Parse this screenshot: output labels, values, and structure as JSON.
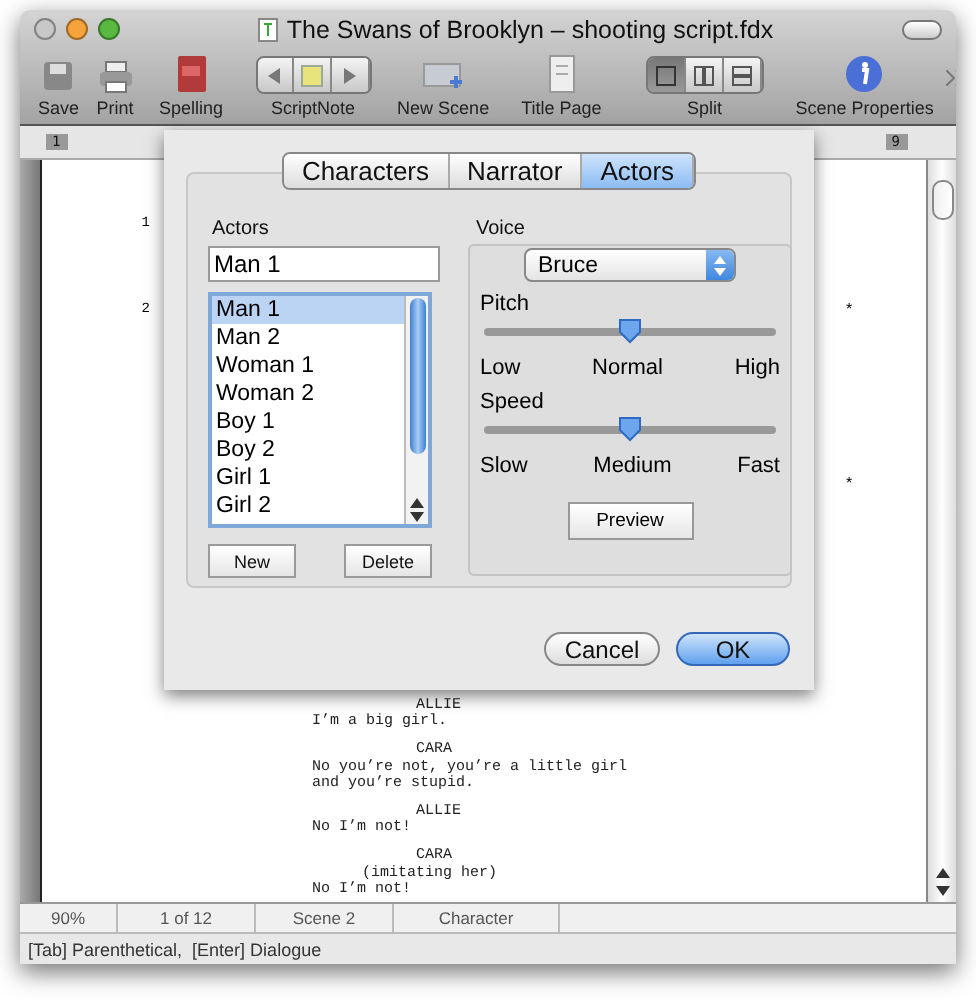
{
  "window": {
    "title": "The Swans of Brooklyn – shooting script.fdx"
  },
  "toolbar": {
    "items": [
      {
        "kind": "save",
        "label": "Save"
      },
      {
        "kind": "print",
        "label": "Print"
      },
      {
        "kind": "spelling",
        "label": "Spelling"
      },
      {
        "kind": "scriptnote",
        "label": "ScriptNote"
      },
      {
        "kind": "newscene",
        "label": "New Scene"
      },
      {
        "kind": "titlepage",
        "label": "Title Page"
      },
      {
        "kind": "split",
        "label": "Split",
        "segments": [
          {
            "kind": "single",
            "selected": true
          },
          {
            "kind": "columns",
            "selected": false
          },
          {
            "kind": "rows",
            "selected": false
          }
        ]
      },
      {
        "kind": "info",
        "label": "Scene Properties"
      }
    ]
  },
  "ruler": {
    "left_label": "1",
    "right_label": "9"
  },
  "page": {
    "scene_numbers": [
      "1",
      "2"
    ],
    "marks": [
      "*",
      "*"
    ],
    "script": [
      {
        "kind": "character",
        "text": "ALLIE"
      },
      {
        "kind": "dialogue",
        "text": "I’m a big girl."
      },
      {
        "kind": "character",
        "text": "CARA"
      },
      {
        "kind": "dialogue",
        "text": "No you’re not, you’re a little girl"
      },
      {
        "kind": "dialogue",
        "text": "and you’re stupid."
      },
      {
        "kind": "character",
        "text": "ALLIE"
      },
      {
        "kind": "dialogue",
        "text": "No I’m not!"
      },
      {
        "kind": "character",
        "text": "CARA"
      },
      {
        "kind": "parenthetical",
        "text": "(imitating her)"
      },
      {
        "kind": "dialogue",
        "text": "No I’m not!"
      }
    ]
  },
  "dialog": {
    "tabs": [
      {
        "label": "Characters",
        "selected": false
      },
      {
        "label": "Narrator",
        "selected": false
      },
      {
        "label": "Actors",
        "selected": true
      }
    ],
    "actors": {
      "label": "Actors",
      "name_value": "Man 1",
      "list": [
        {
          "label": "Man 1",
          "selected": true
        },
        {
          "label": "Man 2",
          "selected": false
        },
        {
          "label": "Woman 1",
          "selected": false
        },
        {
          "label": "Woman 2",
          "selected": false
        },
        {
          "label": "Boy 1",
          "selected": false
        },
        {
          "label": "Boy 2",
          "selected": false
        },
        {
          "label": "Girl 1",
          "selected": false
        },
        {
          "label": "Girl 2",
          "selected": false
        }
      ],
      "buttons": [
        "New",
        "Delete"
      ]
    },
    "voice": {
      "label": "Voice",
      "voice_value": "Bruce",
      "sliders": [
        {
          "label": "Pitch",
          "level": 0.5,
          "ticks": [
            "Low",
            "Normal",
            "High"
          ]
        },
        {
          "label": "Speed",
          "level": 0.5,
          "ticks": [
            "Slow",
            "Medium",
            "Fast"
          ]
        }
      ],
      "preview_button": "Preview"
    },
    "buttons": [
      {
        "label": "Cancel",
        "default": false
      },
      {
        "label": "OK",
        "default": true
      }
    ]
  },
  "status_bar": {
    "zoom": "90%",
    "page": "1 of 12",
    "scene": "Scene 2",
    "element": "Character"
  },
  "hint": "[Tab] Parenthetical,  [Enter] Dialogue"
}
